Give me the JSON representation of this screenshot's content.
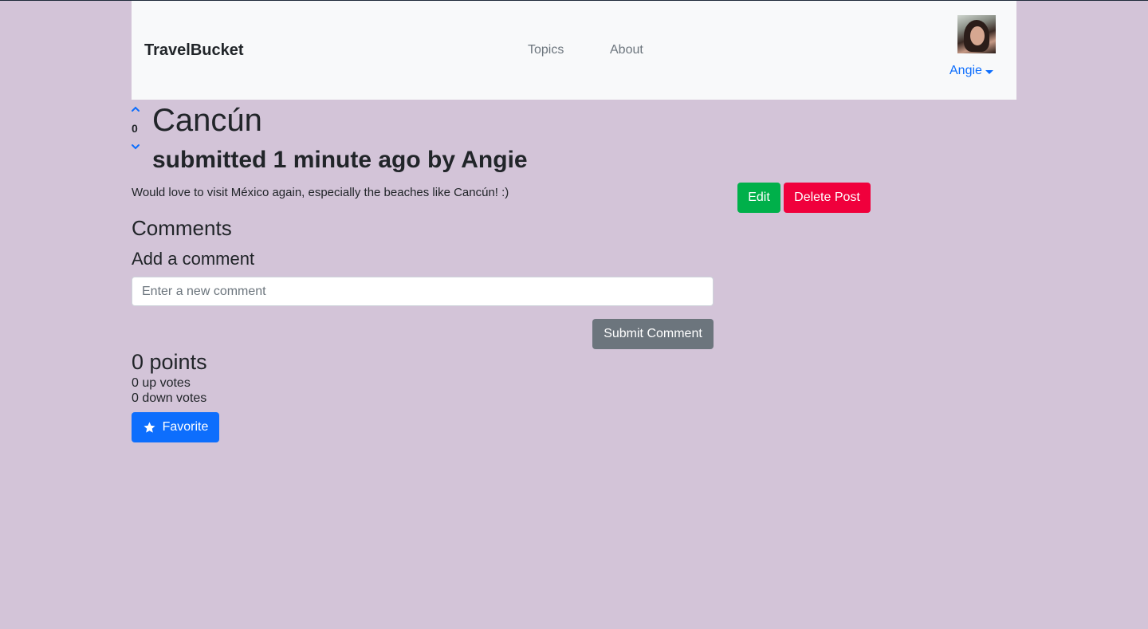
{
  "navbar": {
    "brand": "TravelBucket",
    "links": [
      {
        "label": "Topics"
      },
      {
        "label": "About"
      }
    ],
    "user": {
      "name": "Angie"
    }
  },
  "post": {
    "vote_count": "0",
    "title": "Cancún",
    "submitted": "submitted 1 minute ago by Angie",
    "body": "Would love to visit México again, especially the beaches like Cancún! :)",
    "edit_label": "Edit",
    "delete_label": "Delete Post"
  },
  "comments": {
    "heading": "Comments",
    "add_heading": "Add a comment",
    "placeholder": "Enter a new comment",
    "submit_label": "Submit Comment"
  },
  "votes": {
    "points": "0 points",
    "up": "0 up votes",
    "down": "0 down votes",
    "favorite_label": "Favorite"
  },
  "colors": {
    "background": "#d3c4d8",
    "primary": "#0d6efd",
    "success": "#00b04a",
    "danger": "#f0003c",
    "secondary": "#6c757d"
  },
  "icons": [
    "chevron-up-icon",
    "chevron-down-icon",
    "star-icon",
    "caret-down-icon"
  ]
}
